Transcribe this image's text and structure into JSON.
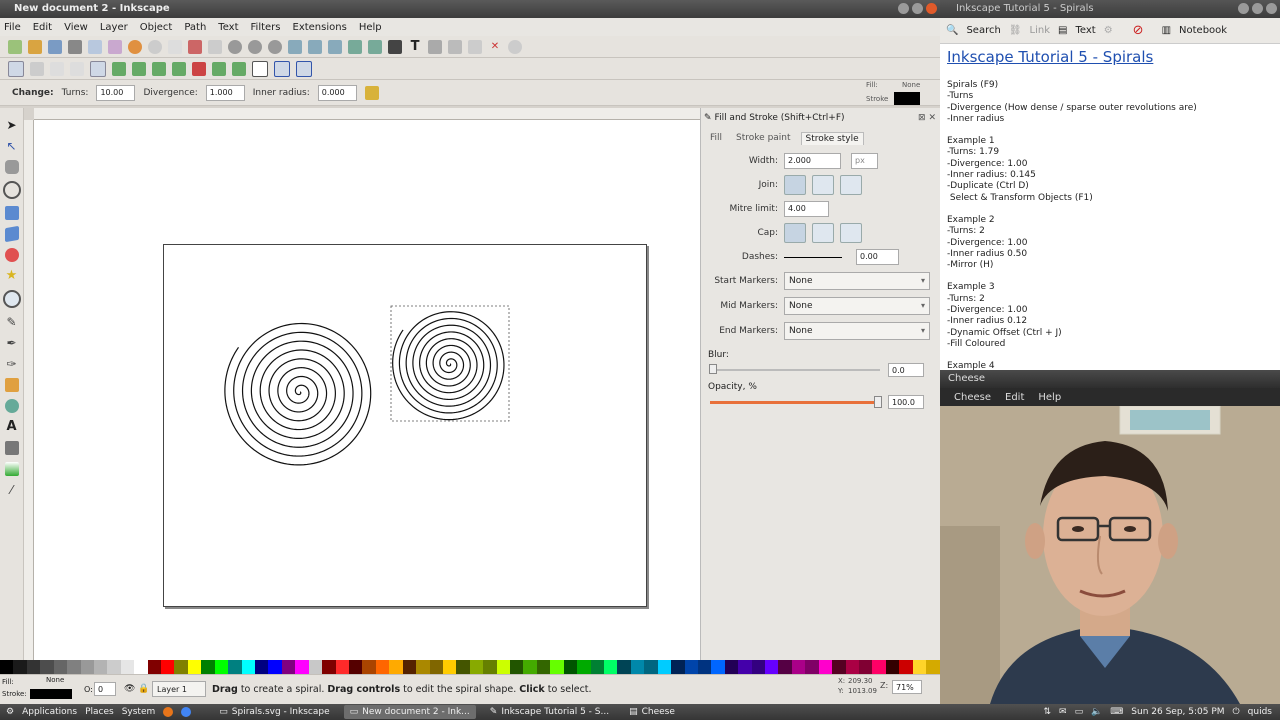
{
  "inkscape": {
    "title": "New document 2 - Inkscape",
    "menu": [
      "File",
      "Edit",
      "View",
      "Layer",
      "Object",
      "Path",
      "Text",
      "Filters",
      "Extensions",
      "Help"
    ],
    "controls": {
      "change_label": "Change:",
      "turns_label": "Turns:",
      "turns_value": "10.00",
      "divergence_label": "Divergence:",
      "divergence_value": "1.000",
      "inner_radius_label": "Inner radius:",
      "inner_radius_value": "0.000"
    },
    "style_indicator": {
      "fill_label": "Fill:",
      "fill_value": "None",
      "stroke_label": "Stroke"
    },
    "status": {
      "fill_label": "Fill:",
      "fill_value": "None",
      "stroke_label": "Stroke:",
      "opacity_value": "0",
      "layer_value": "Layer 1",
      "message_part1": "Drag",
      "message_part2": " to create a spiral. ",
      "message_part3": "Drag controls",
      "message_part4": " to edit the spiral shape. ",
      "message_part5": "Click",
      "message_part6": " to select.",
      "x_coord": "209.30",
      "y_coord": "1013.09",
      "zoom": "71%"
    }
  },
  "fill_stroke": {
    "title": "Fill and Stroke (Shift+Ctrl+F)",
    "tabs": [
      "Fill",
      "Stroke paint",
      "Stroke style"
    ],
    "width_label": "Width:",
    "width_value": "2.000",
    "width_unit": "px",
    "join_label": "Join:",
    "mitre_label": "Mitre limit:",
    "mitre_value": "4.00",
    "cap_label": "Cap:",
    "dashes_label": "Dashes:",
    "dashes_value": "0.00",
    "start_markers_label": "Start Markers:",
    "start_markers_value": "None",
    "mid_markers_label": "Mid Markers:",
    "mid_markers_value": "None",
    "end_markers_label": "End Markers:",
    "end_markers_value": "None",
    "blur_label": "Blur:",
    "blur_value": "0.0",
    "opacity_label": "Opacity, %",
    "opacity_value": "100.0"
  },
  "notebook": {
    "window_title": "Inkscape Tutorial 5 - Spirals",
    "toolbar": {
      "search": "Search",
      "link": "Link",
      "text": "Text",
      "notebook": "Notebook"
    },
    "heading": "Inkscape Tutorial 5 - Spirals",
    "lines": [
      "Spirals (F9)",
      "-Turns",
      "-Divergence (How dense / sparse outer revolutions are)",
      "-Inner radius",
      "",
      "Example 1",
      "-Turns: 1.79",
      "-Divergence: 1.00",
      "-Inner radius: 0.145",
      "-Duplicate (Ctrl D)",
      " Select & Transform Objects (F1)",
      "",
      "Example 2",
      "-Turns: 2",
      "-Divergence: 1.00",
      "-Inner radius 0.50",
      "-Mirror (H)",
      "",
      "Example 3",
      "-Turns: 2",
      "-Divergence: 1.00",
      "-Inner radius 0.12",
      "-Dynamic Offset (Ctrl + J)",
      "-Fill Coloured",
      "",
      "Example 4"
    ]
  },
  "cheese": {
    "title": "Cheese",
    "menu": [
      "Cheese",
      "Edit",
      "Help"
    ]
  },
  "taskbar": {
    "applications": "Applications",
    "places": "Places",
    "system": "System",
    "tasks": [
      "Spirals.svg - Inkscape",
      "New document 2 - Ink...",
      "Inkscape Tutorial 5 - S...",
      "Cheese"
    ],
    "clock": "Sun 26 Sep,  5:05 PM",
    "user": "quids"
  },
  "palette": [
    "#000000",
    "#1a1a1a",
    "#333333",
    "#4d4d4d",
    "#666666",
    "#808080",
    "#999999",
    "#b3b3b3",
    "#cccccc",
    "#e6e6e6",
    "#ffffff",
    "#800000",
    "#ff0000",
    "#808000",
    "#ffff00",
    "#008000",
    "#00ff00",
    "#008080",
    "#00ffff",
    "#000080",
    "#0000ff",
    "#800080",
    "#ff00ff",
    "#c8c8c8",
    "#7f0000",
    "#ff2a2a",
    "#550000",
    "#aa4400",
    "#ff6600",
    "#ffaa00",
    "#552200",
    "#aa8800",
    "#806600",
    "#ffcc00",
    "#445500",
    "#88aa00",
    "#668000",
    "#ccff00",
    "#225500",
    "#44aa00",
    "#336600",
    "#66ff00",
    "#005500",
    "#00aa00",
    "#008033",
    "#00ff66",
    "#004455",
    "#0088aa",
    "#006680",
    "#00ccff",
    "#002255",
    "#0044aa",
    "#003380",
    "#0066ff",
    "#220055",
    "#4400aa",
    "#330080",
    "#6600ff",
    "#550044",
    "#aa0088",
    "#800066",
    "#ff00cc",
    "#550022",
    "#aa0044",
    "#800033",
    "#ff0066",
    "#330000",
    "#cc0000",
    "#ffd42a",
    "#d4aa00"
  ]
}
